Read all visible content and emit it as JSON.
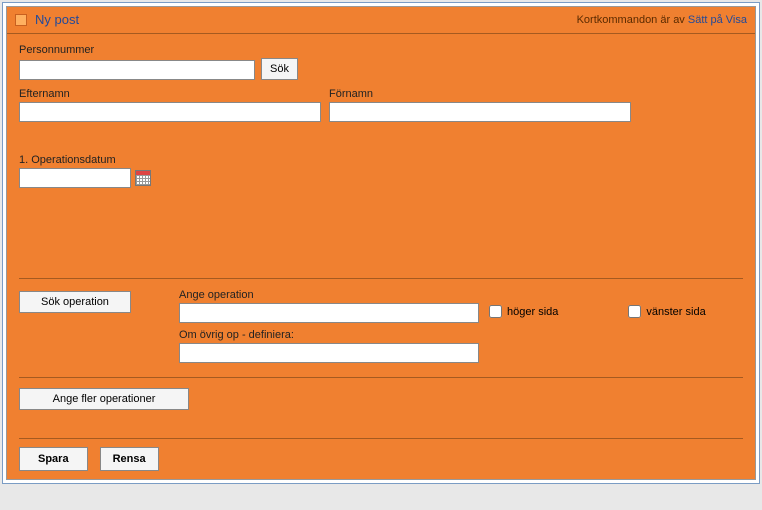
{
  "header": {
    "title": "Ny post",
    "shortcuts_text": "Kortkommandon är av",
    "link_toggle": "Sätt på",
    "link_show": "Visa"
  },
  "fields": {
    "personnummer_label": "Personnummer",
    "personnummer_value": "",
    "sok_button": "Sök",
    "efternamn_label": "Efternamn",
    "efternamn_value": "",
    "fornamn_label": "Förnamn",
    "fornamn_value": "",
    "operationsdatum_label": "1. Operationsdatum",
    "operationsdatum_value": ""
  },
  "operation": {
    "sok_operation_button": "Sök operation",
    "ange_operation_label": "Ange operation",
    "ange_operation_value": "",
    "hoger_label": "höger sida",
    "vanster_label": "vänster sida",
    "ovrig_label": "Om övrig op - definiera:",
    "ovrig_value": "",
    "ange_fler_button": "Ange fler operationer"
  },
  "footer": {
    "save": "Spara",
    "clear": "Rensa"
  }
}
